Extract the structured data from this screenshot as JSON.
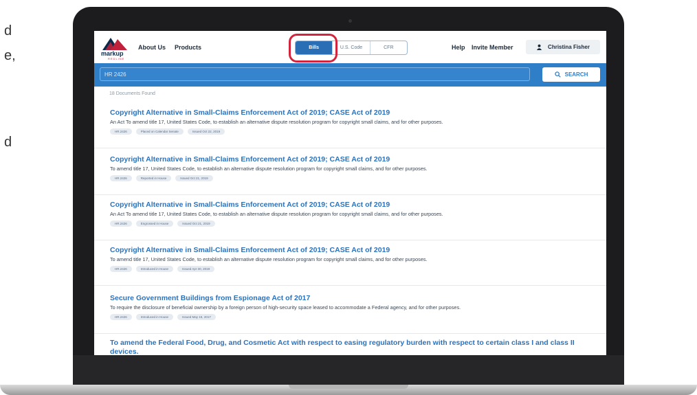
{
  "side_fragments": [
    "d",
    "e,",
    "d"
  ],
  "logo": {
    "name": "markup",
    "tagline": "REDLINE"
  },
  "nav": {
    "about": "About Us",
    "products": "Products",
    "help": "Help",
    "invite": "Invite Member"
  },
  "tabs": [
    {
      "label": "Bills",
      "active": true
    },
    {
      "label": "U.S. Code",
      "active": false
    },
    {
      "label": "CFR",
      "active": false
    }
  ],
  "user": {
    "name": "Christina Fisher",
    "icon": "user-icon"
  },
  "search": {
    "value": "HR 2426",
    "button_label": "SEARCH",
    "icon": "search-icon"
  },
  "results_count": "18 Documents Found",
  "results": [
    {
      "title": "Copyright Alternative in Small-Claims Enforcement Act of 2019; CASE Act of 2019",
      "description": "An Act To amend title 17, United States Code, to establish an alternative dispute resolution program for copyright small claims, and for other purposes.",
      "tags": [
        "HR.2426",
        "Placed on Calendar Senate",
        "Issued Oct 22, 2019"
      ]
    },
    {
      "title": "Copyright Alternative in Small-Claims Enforcement Act of 2019; CASE Act of 2019",
      "description": "To amend title 17, United States Code, to establish an alternative dispute resolution program for copyright small claims, and for other purposes.",
      "tags": [
        "HR.2426",
        "Reported in House",
        "Issued Oct 21, 2019"
      ]
    },
    {
      "title": "Copyright Alternative in Small-Claims Enforcement Act of 2019; CASE Act of 2019",
      "description": "An Act To amend title 17, United States Code, to establish an alternative dispute resolution program for copyright small claims, and for other purposes.",
      "tags": [
        "HR.2426",
        "Engrossed in House",
        "Issued Oct 21, 2019"
      ]
    },
    {
      "title": "Copyright Alternative in Small-Claims Enforcement Act of 2019; CASE Act of 2019",
      "description": "To amend title 17, United States Code, to establish an alternative dispute resolution program for copyright small claims, and for other purposes.",
      "tags": [
        "HR.2426",
        "Introduced in House",
        "Issued Apr 30, 2019"
      ]
    },
    {
      "title": "Secure Government Buildings from Espionage Act of 2017",
      "description": "To require the disclosure of beneficial ownership by a foreign person of high-security space leased to accommodate a Federal agency, and for other purposes.",
      "tags": [
        "HR.2426",
        "Introduced in House",
        "Issued May 15, 2017"
      ]
    }
  ],
  "last_result_title": "To amend the Federal Food, Drug, and Cosmetic Act with respect to easing regulatory burden with respect to certain class I and class II devices.",
  "colors": {
    "brand_blue": "#2f7fc8",
    "link_blue": "#2c72bb",
    "highlight_red": "#d3243e",
    "logo_red": "#c0223c",
    "logo_navy": "#0b2a4a"
  }
}
